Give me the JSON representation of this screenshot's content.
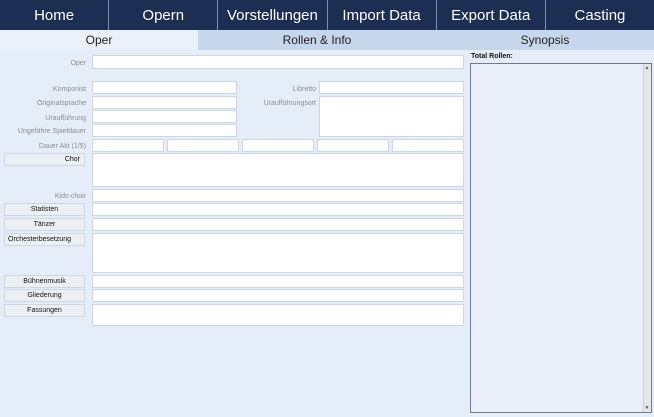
{
  "nav": [
    "Home",
    "Opern",
    "Vorstellungen",
    "Import Data",
    "Export Data",
    "Casting"
  ],
  "tabs": [
    "Oper",
    "Rollen & Info",
    "Synopsis"
  ],
  "form": {
    "oper": "Oper",
    "komponist": "Komponist",
    "originalsprache": "Originalsprache",
    "urauffuehrung": "Uraufführung",
    "spieldauer": "Ungefähre Spieldauer",
    "libretto": "Libretto",
    "urauffuehrungsort": "Uraufführungsort",
    "dauer_akt": "Dauer  Akt (1/5)",
    "chor": "Chor",
    "kids_choir": "Kids-choir",
    "statisten": "Statisten",
    "taenzer": "Tänzer",
    "orchesterbesetzung": "Orchesterbesetzung",
    "buehnenmusik": "Bühnenmusik",
    "gliederung": "Gliederung",
    "fassungen": "Fassungen"
  },
  "sidebar": {
    "title": "Total Rollen:"
  },
  "icons": {
    "scroll_up": "▲",
    "scroll_down": "▼"
  },
  "colors": {
    "nav_bg": "#1c2e52",
    "tab_bg": "#c6d7eb",
    "page_bg": "#e4edf8"
  }
}
